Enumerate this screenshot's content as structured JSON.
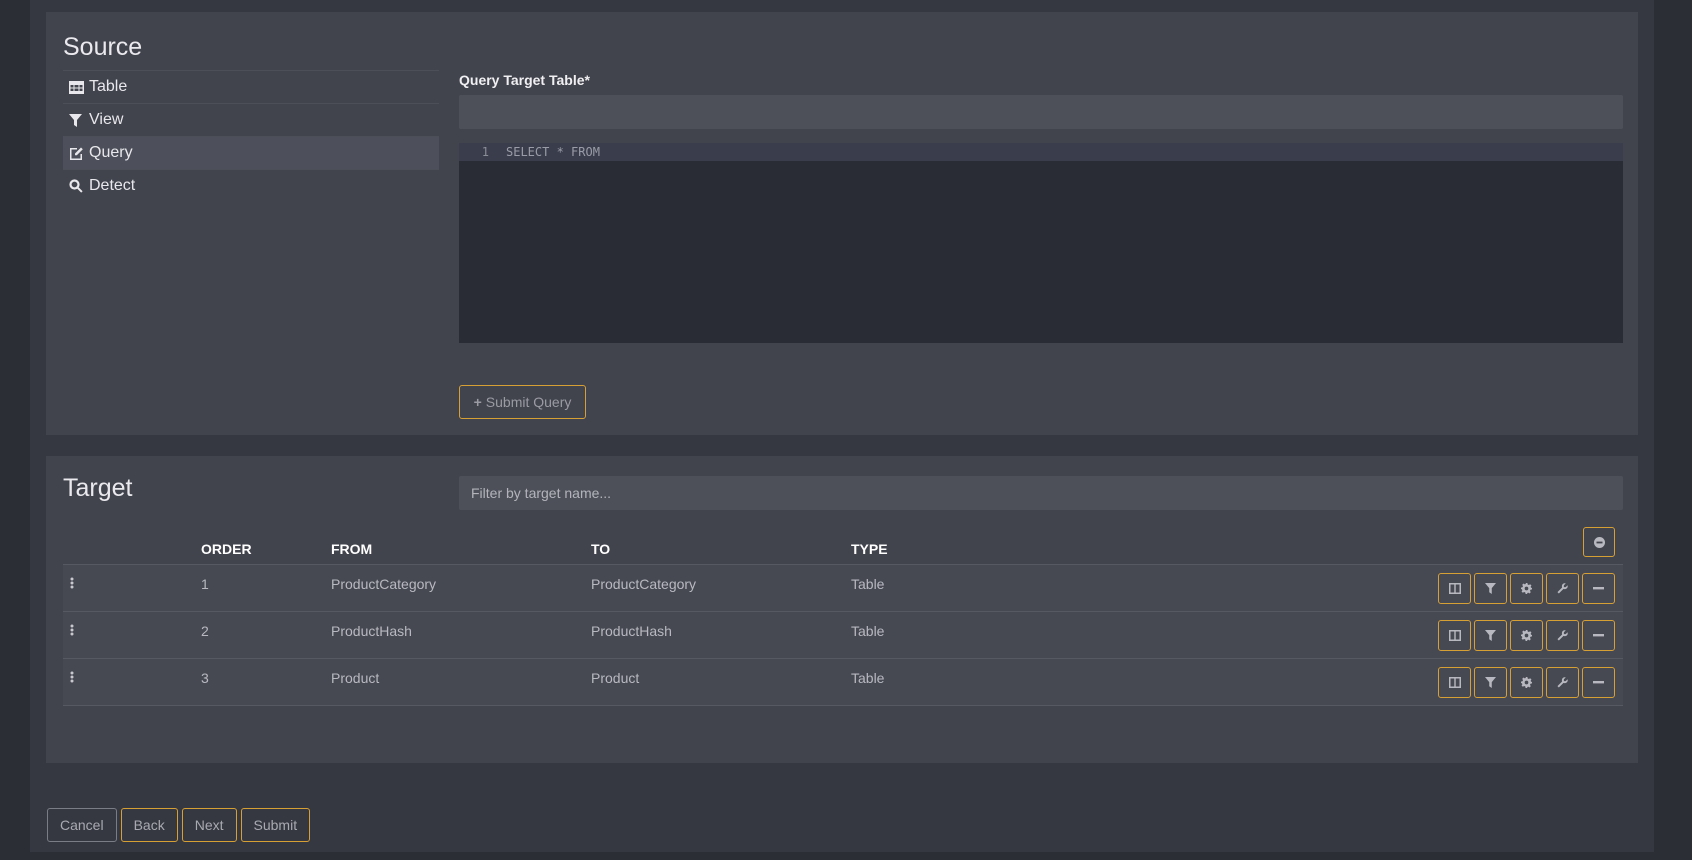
{
  "source": {
    "title": "Source",
    "items": [
      {
        "label": "Table",
        "icon": "table-icon"
      },
      {
        "label": "View",
        "icon": "filter-icon"
      },
      {
        "label": "Query",
        "icon": "edit-icon",
        "active": true
      },
      {
        "label": "Detect",
        "icon": "search-icon"
      }
    ],
    "query_label": "Query Target Table*",
    "query_value": "",
    "editor": {
      "line_number": "1",
      "code": "SELECT * FROM"
    },
    "submit_query_label": "Submit Query"
  },
  "target": {
    "title": "Target",
    "filter_placeholder": "Filter by target name...",
    "columns": {
      "order": "ORDER",
      "from": "FROM",
      "to": "TO",
      "type": "TYPE"
    },
    "rows": [
      {
        "order": "1",
        "from": "ProductCategory",
        "to": "ProductCategory",
        "type": "Table"
      },
      {
        "order": "2",
        "from": "ProductHash",
        "to": "ProductHash",
        "type": "Table"
      },
      {
        "order": "3",
        "from": "Product",
        "to": "Product",
        "type": "Table"
      }
    ]
  },
  "footer": {
    "cancel": "Cancel",
    "back": "Back",
    "next": "Next",
    "submit": "Submit"
  },
  "colors": {
    "accent": "#d6a035",
    "panel": "#41434d",
    "background": "#363841"
  }
}
